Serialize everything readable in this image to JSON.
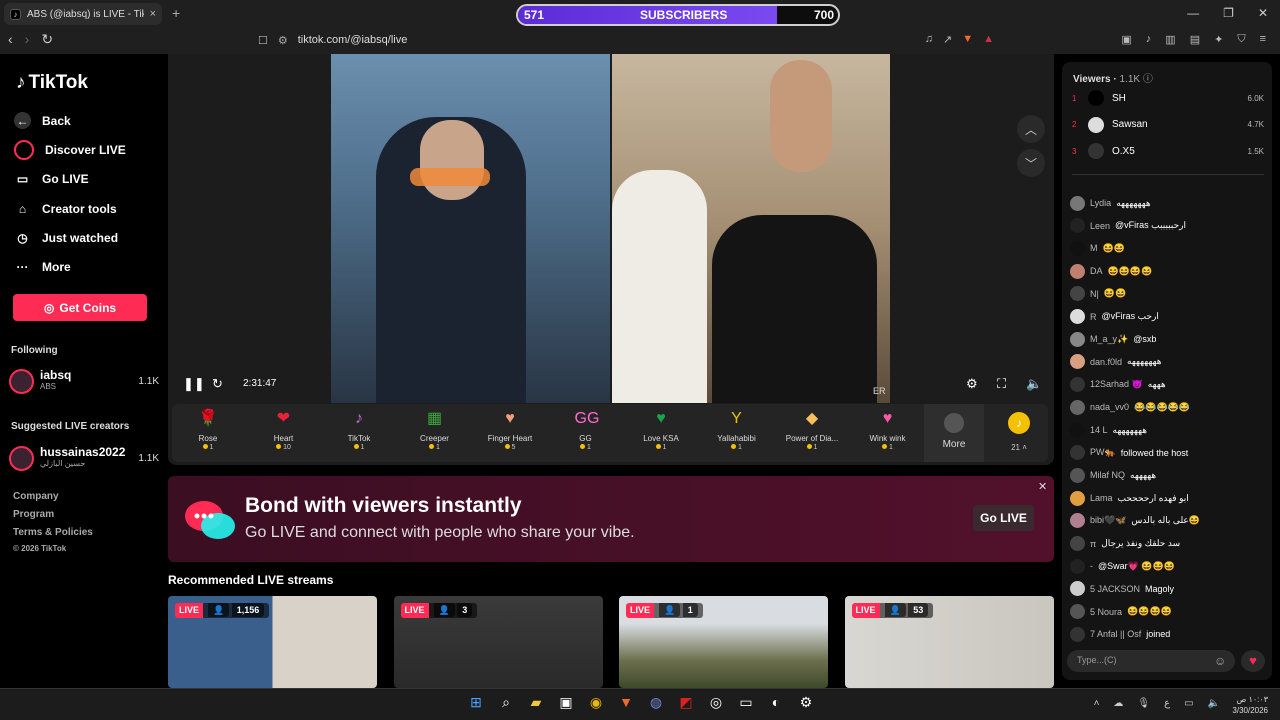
{
  "browser": {
    "tab_title": "ABS (@iabsq) is LIVE - TikTok",
    "tab_close": "×",
    "new_tab": "+",
    "url": "tiktok.com/@iabsq/live"
  },
  "subscriber_bar": {
    "left": "571",
    "label": "SUBSCRIBERS",
    "right": "700",
    "progress": 0.81
  },
  "sidebar": {
    "logo": "TikTok",
    "menu": [
      {
        "label": "Back",
        "icon": "back-arrow-icon"
      },
      {
        "label": "Discover LIVE",
        "icon": "live-icon"
      },
      {
        "label": "Go LIVE",
        "icon": "camera-icon"
      },
      {
        "label": "Creator tools",
        "icon": "home-icon"
      },
      {
        "label": "Just watched",
        "icon": "history-icon"
      },
      {
        "label": "More",
        "icon": "more-icon"
      }
    ],
    "get_coins": "Get Coins",
    "following_title": "Following",
    "following": {
      "name": "iabsq",
      "sub": "ABS",
      "count": "1.1K"
    },
    "suggested_title": "Suggested LIVE creators",
    "suggested": {
      "name": "hussainas2022",
      "sub": "حسين البازلي",
      "count": "1.1K"
    },
    "footer": [
      "Company",
      "Program",
      "Terms & Policies",
      "© 2026 TikTok"
    ]
  },
  "player": {
    "time": "2:31:47",
    "er_label": "ER"
  },
  "gifts": [
    {
      "name": "Rose",
      "price": "1",
      "icon": "rose-icon",
      "glyph": "🌹"
    },
    {
      "name": "Heart",
      "price": "10",
      "icon": "heart-icon",
      "glyph": "❤"
    },
    {
      "name": "TikTok",
      "price": "1",
      "icon": "tiktok-gift-icon",
      "glyph": "♪"
    },
    {
      "name": "Creeper",
      "price": "1",
      "icon": "creeper-icon",
      "glyph": "▦"
    },
    {
      "name": "Finger Heart",
      "price": "5",
      "icon": "finger-heart-icon",
      "glyph": "♥"
    },
    {
      "name": "GG",
      "price": "1",
      "icon": "gg-icon",
      "glyph": "GG"
    },
    {
      "name": "Love KSA",
      "price": "1",
      "icon": "love-ksa-icon",
      "glyph": "♥"
    },
    {
      "name": "Yallahabibi",
      "price": "1",
      "icon": "yallahabibi-icon",
      "glyph": "Y"
    },
    {
      "name": "Power of Dia...",
      "price": "1",
      "icon": "diamond-icon",
      "glyph": "◆"
    },
    {
      "name": "Wink wink",
      "price": "1",
      "icon": "wink-icon",
      "glyph": "♥"
    }
  ],
  "gifts_more": "More",
  "coin_balance": "21",
  "banner": {
    "title": "Bond with viewers instantly",
    "subtitle": "Go LIVE and connect with people who share your vibe.",
    "button": "Go LIVE"
  },
  "recommended_title": "Recommended LIVE streams",
  "streams": [
    {
      "live": "LIVE",
      "viewers": "1,156"
    },
    {
      "live": "LIVE",
      "viewers": "3"
    },
    {
      "live": "LIVE",
      "viewers": "1"
    },
    {
      "live": "LIVE",
      "viewers": "53"
    }
  ],
  "chat": {
    "viewers_label": "Viewers",
    "viewers_count": "1.1K",
    "top_viewers": [
      {
        "rank": "1",
        "name": "SH",
        "count": "6.0K"
      },
      {
        "rank": "2",
        "name": "Sawsan",
        "count": "4.7K"
      },
      {
        "rank": "3",
        "name": "O.X5",
        "count": "1.5K"
      }
    ],
    "messages": [
      {
        "user": "Lydia",
        "text": "هههههههه"
      },
      {
        "user": "Leen",
        "text": "@vFiras ارحبببببب"
      },
      {
        "user": "M",
        "text": "😆😆"
      },
      {
        "user": "DA",
        "text": "😆😆😆😆"
      },
      {
        "user": "N|",
        "text": "😆😆"
      },
      {
        "user": "R",
        "text": "@vFiras ارحب"
      },
      {
        "user": "M_a_y✨",
        "text": "@sxb"
      },
      {
        "user": "dan.f0ld",
        "text": "هههههههه"
      },
      {
        "user": "12Sarhad 👿",
        "text": "هههه"
      },
      {
        "user": "nada_vv0",
        "text": "😂😂😂😂😂"
      },
      {
        "user": "14 L",
        "text": "هههههههه"
      },
      {
        "user": "PW🐅",
        "text": "followed the host"
      },
      {
        "user": "Milaf NQ",
        "text": "هههههه"
      },
      {
        "user": "Lama",
        "text": "ابو فهده ارححححب"
      },
      {
        "user": "bibi🖤🦋",
        "text": "على باله بالدس😆"
      },
      {
        "user": "π",
        "text": "سد حلقك ونفذ يرجال"
      },
      {
        "user": "-",
        "text": "@Swar💗 😆😆😆"
      },
      {
        "user": "5 JACKSON",
        "text": "Magoly"
      },
      {
        "user": "5 Noura",
        "text": "😆😆😆😆"
      },
      {
        "user": "7 Anfal || Osf",
        "text": "joined"
      }
    ],
    "input_placeholder": "Type...(C)"
  },
  "clock": {
    "time": "١٠:٠٣ ص",
    "date": "3/30/2026"
  },
  "colors": {
    "accent": "#fe2c55",
    "sub_bar": "#6a38e6",
    "banner": "#4a1027"
  }
}
